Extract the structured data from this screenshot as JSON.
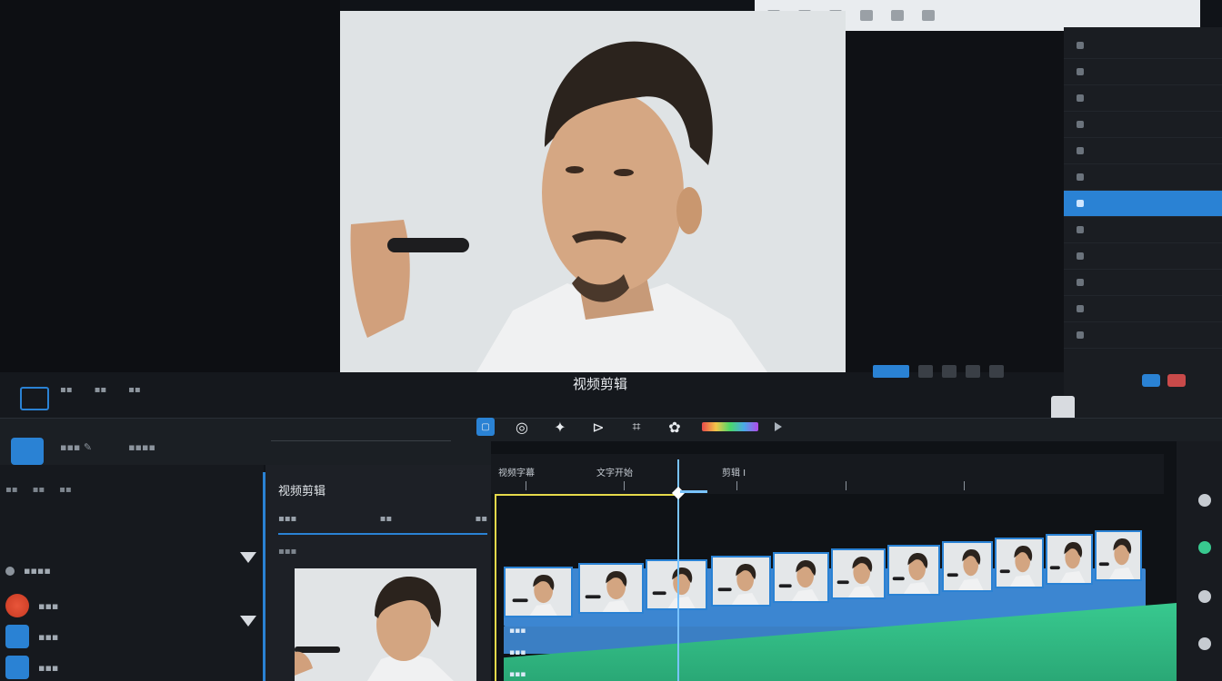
{
  "viewer": {
    "caption": "视频剪辑"
  },
  "toolbar": {
    "tools": [
      "select-tool",
      "record-tool",
      "split-tool",
      "trim-tool",
      "crop-tool",
      "color-tool"
    ]
  },
  "media": {
    "title": "视频剪辑"
  },
  "timeline": {
    "ruler_labels": [
      "视频字幕",
      "文字开始",
      "剪辑 I"
    ]
  },
  "colors": {
    "accent": "#2a82d4",
    "selection": "#e6d94a",
    "playhead": "#79c3ff",
    "audio": "#38c98f"
  }
}
